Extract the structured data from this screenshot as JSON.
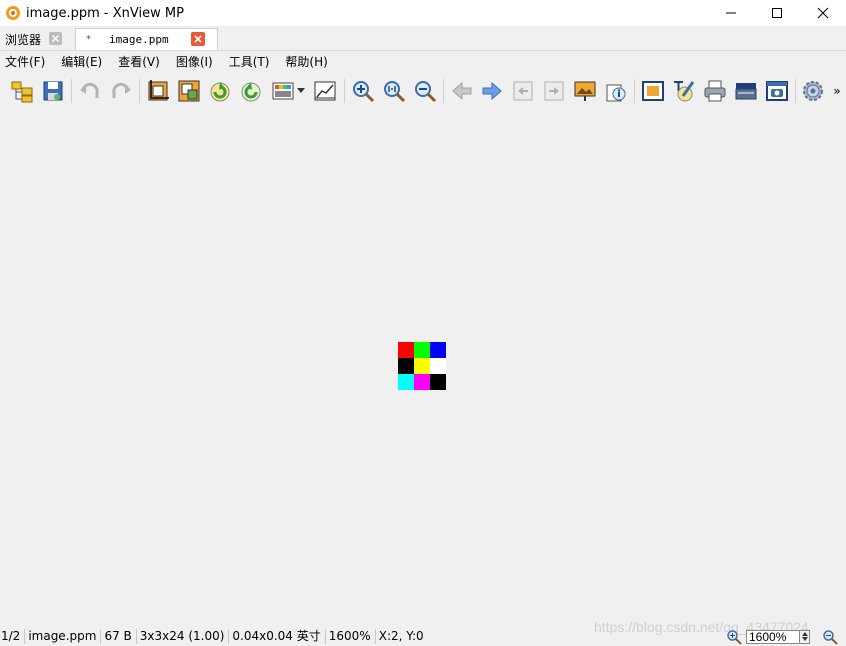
{
  "window": {
    "title": "image.ppm - XnView MP"
  },
  "tabs": [
    {
      "label": "浏览器"
    },
    {
      "label": "image.ppm",
      "modified_mark": "*"
    }
  ],
  "menu": [
    "文件(F)",
    "编辑(E)",
    "查看(V)",
    "图像(I)",
    "工具(T)",
    "帮助(H)"
  ],
  "toolbar": {
    "icons": [
      "browser-icon",
      "save-icon",
      "undo-icon",
      "redo-icon",
      "crop-icon",
      "resize-icon",
      "rotate-left-icon",
      "rotate-right-icon",
      "adjust-colors-icon",
      "levels-icon",
      "zoom-in-icon",
      "zoom-actual-icon",
      "zoom-out-icon",
      "previous-icon",
      "next-icon",
      "first-icon",
      "last-icon",
      "slideshow-icon",
      "info-icon",
      "fullscreen-icon",
      "edit-icon",
      "print-icon",
      "scan-icon",
      "capture-icon",
      "settings-icon"
    ],
    "overflow": "»"
  },
  "image_pixels": [
    "#ff0000",
    "#00ff00",
    "#0000ff",
    "#000000",
    "#ffff00",
    "#ffffff",
    "#00ffff",
    "#ff00ff",
    "#000000"
  ],
  "status": {
    "index": "1/2",
    "filename": "image.ppm",
    "size": "67 B",
    "dimensions": "3x3x24 (1.00)",
    "print_size": "0.04x0.04 英寸",
    "zoom": "1600%",
    "coords": "X:2, Y:0"
  },
  "zoom_control": {
    "value": "1600%"
  },
  "watermark": "https://blog.csdn.net/qq_43477024"
}
